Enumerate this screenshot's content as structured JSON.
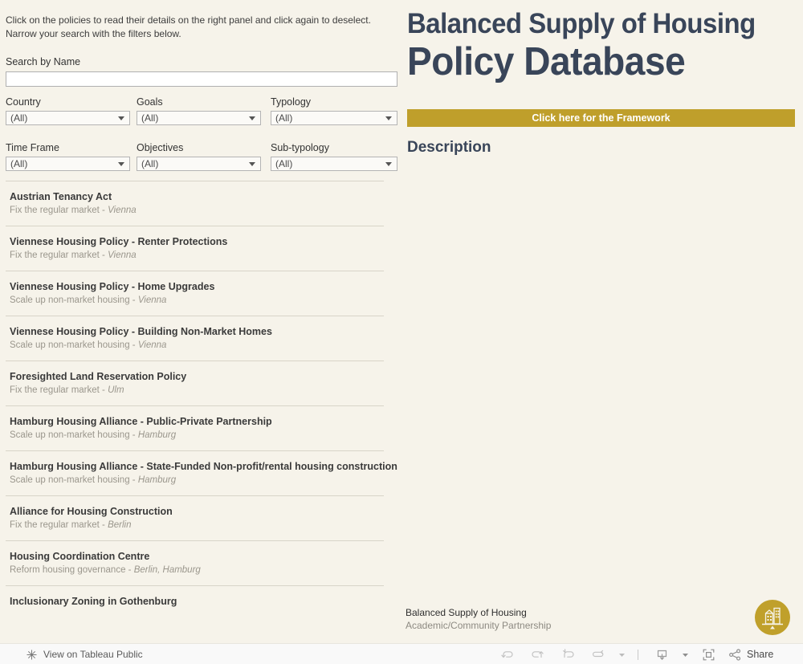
{
  "left": {
    "intro": "Click on the policies to read their details on the right panel and click again to deselect. Narrow your search with the filters below.",
    "search": {
      "label": "Search by Name",
      "value": "",
      "placeholder": ""
    },
    "filters": [
      {
        "label": "Country",
        "value": "(All)"
      },
      {
        "label": "Goals",
        "value": "(All)"
      },
      {
        "label": "Typology",
        "value": "(All)"
      },
      {
        "label": "Time Frame",
        "value": "(All)"
      },
      {
        "label": "Objectives",
        "value": "(All)"
      },
      {
        "label": "Sub-typology",
        "value": "(All)"
      }
    ],
    "policies": [
      {
        "title": "Austrian Tenancy Act",
        "goal": "Fix the regular market",
        "sep": " - ",
        "location": "Vienna"
      },
      {
        "title": "Viennese Housing Policy - Renter Protections",
        "goal": "Fix the regular market",
        "sep": " - ",
        "location": "Vienna"
      },
      {
        "title": "Viennese Housing Policy - Home Upgrades",
        "goal": "Scale up non-market housing",
        "sep": " - ",
        "location": "Vienna"
      },
      {
        "title": "Viennese Housing Policy - Building Non-Market Homes",
        "goal": "Scale up non-market housing",
        "sep": " - ",
        "location": "Vienna"
      },
      {
        "title": "Foresighted Land Reservation Policy",
        "goal": "Fix the regular market",
        "sep": " - ",
        "location": "Ulm"
      },
      {
        "title": "Hamburg Housing Alliance - Public-Private Partnership",
        "goal": "Scale up non-market housing",
        "sep": " - ",
        "location": "Hamburg"
      },
      {
        "title": "Hamburg Housing Alliance - State-Funded Non-profit/rental housing construction",
        "goal": "Scale up non-market housing",
        "sep": " - ",
        "location": "Hamburg"
      },
      {
        "title": "Alliance for Housing Construction",
        "goal": "Fix the regular market",
        "sep": " - ",
        "location": "Berlin"
      },
      {
        "title": "Housing Coordination Centre",
        "goal": "Reform housing governance",
        "sep": " - ",
        "location": "Berlin, Hamburg"
      },
      {
        "title": "Inclusionary Zoning in Gothenburg",
        "goal": "",
        "sep": "",
        "location": ""
      }
    ]
  },
  "right": {
    "title_line1": "Balanced Supply of Housing",
    "title_line2": "Policy Database",
    "framework_button": "Click here for the Framework",
    "description_heading": "Description",
    "description_body": ""
  },
  "brand": {
    "line1": "Balanced Supply of Housing",
    "line2": "Academic/Community Partnership",
    "logo_icon": "building-balance-logo"
  },
  "toolbar": {
    "view_label": "View on Tableau Public",
    "tableau_icon": "tableau-flower-icon",
    "buttons": [
      {
        "name": "undo-button",
        "icon": "undo-icon"
      },
      {
        "name": "redo-button",
        "icon": "redo-icon"
      },
      {
        "name": "revert-button",
        "icon": "revert-icon"
      },
      {
        "name": "refresh-button",
        "icon": "refresh-icon"
      },
      {
        "name": "refresh-dropdown",
        "icon": "caret-down-icon"
      },
      {
        "name": "download-button",
        "icon": "download-icon"
      },
      {
        "name": "download-dropdown",
        "icon": "caret-down-icon"
      },
      {
        "name": "fullscreen-button",
        "icon": "fullscreen-icon"
      }
    ],
    "share_label": "Share",
    "share_icon": "share-icon"
  },
  "colors": {
    "page_background": "#f6f3ea",
    "accent_gold": "#bf9f2b",
    "title_navy": "#394559",
    "toolbar_background": "#f9f9f9",
    "row_divider": "#d8d4c8",
    "muted_text": "#9a968c"
  }
}
